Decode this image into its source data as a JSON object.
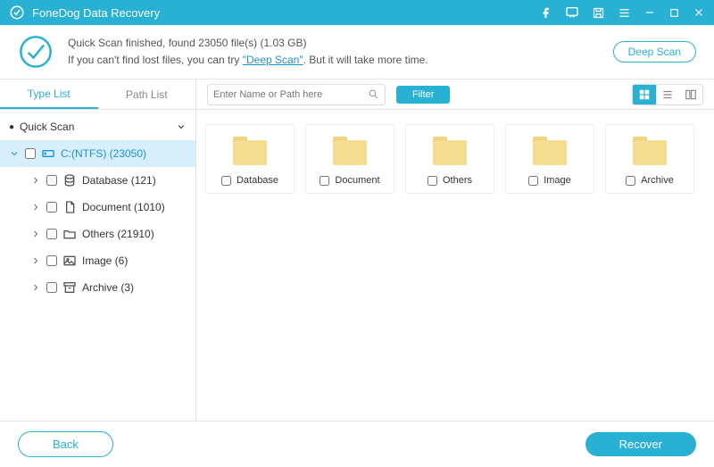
{
  "app": {
    "title": "FoneDog Data Recovery"
  },
  "status": {
    "line1": "Quick Scan finished, found 23050 file(s) (1.03 GB)",
    "line2_pre": "If you can't find lost files, you can try ",
    "line2_link": "\"Deep Scan\"",
    "line2_post": ". But it will take more time.",
    "deep_scan_label": "Deep Scan"
  },
  "sidebar": {
    "tabs": {
      "type_list": "Type List",
      "path_list": "Path List"
    },
    "root": {
      "label": "Quick Scan",
      "bullet": "●"
    },
    "drive": {
      "label": "C:(NTFS) (23050)"
    },
    "categories": [
      {
        "label": "Database (121)"
      },
      {
        "label": "Document (1010)"
      },
      {
        "label": "Others (21910)"
      },
      {
        "label": "Image (6)"
      },
      {
        "label": "Archive (3)"
      }
    ]
  },
  "toolbar": {
    "search_placeholder": "Enter Name or Path here",
    "filter_label": "Filter"
  },
  "folders": [
    {
      "label": "Database"
    },
    {
      "label": "Document"
    },
    {
      "label": "Others"
    },
    {
      "label": "Image"
    },
    {
      "label": "Archive"
    }
  ],
  "footer": {
    "back": "Back",
    "recover": "Recover"
  }
}
